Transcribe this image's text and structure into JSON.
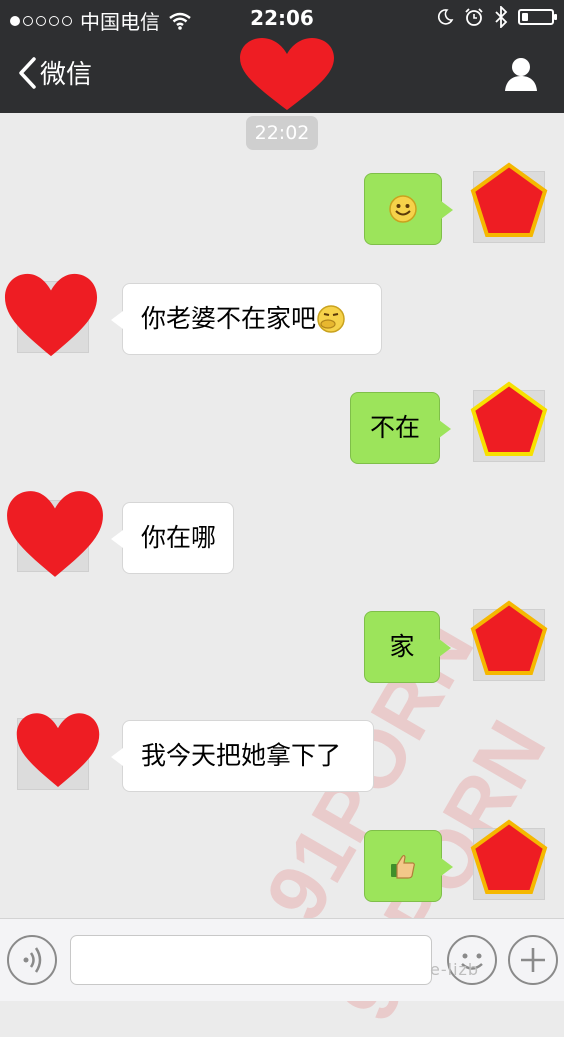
{
  "status": {
    "carrier": "中国电信",
    "time": "22:06",
    "signal_dots_filled": 1,
    "signal_dots_total": 5,
    "battery_level": 0.2
  },
  "nav": {
    "back_label": "微信",
    "back_icon": "chevron-left-icon",
    "title_icon": "heart-icon",
    "profile_icon": "person-icon"
  },
  "chat": {
    "timestamp": "22:02",
    "messages": [
      {
        "side": "right",
        "text": "",
        "emoji": "smile-emoji"
      },
      {
        "side": "left",
        "text": "你老婆不在家吧",
        "emoji": "thinking-emoji"
      },
      {
        "side": "right",
        "text": "不在"
      },
      {
        "side": "left",
        "text": "你在哪"
      },
      {
        "side": "right",
        "text": "家"
      },
      {
        "side": "left",
        "text": "我今天把她拿下了"
      },
      {
        "side": "right",
        "text": "",
        "emoji": "thumbs-up-emoji"
      }
    ]
  },
  "watermark": {
    "text": "91PORN"
  },
  "input_bar": {
    "voice_icon": "voice-icon",
    "emoji_icon": "emoji-face-icon",
    "plus_icon": "plus-icon",
    "site_tag": "e-lizb"
  },
  "colors": {
    "bar_bg": "#2e2f31",
    "chat_bg": "#ebebeb",
    "bubble_green": "#9ce45b",
    "bubble_white": "#ffffff",
    "avatar_red": "#ee1d23",
    "avatar_outline": "#f5b800"
  }
}
